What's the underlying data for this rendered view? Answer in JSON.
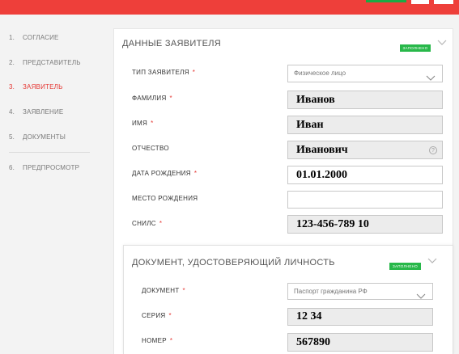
{
  "sidebar": {
    "items": [
      {
        "num": "1.",
        "label": "СОГЛАСИЕ"
      },
      {
        "num": "2.",
        "label": "ПРЕДСТАВИТЕЛЬ"
      },
      {
        "num": "3.",
        "label": "ЗАЯВИТЕЛЬ"
      },
      {
        "num": "4.",
        "label": "ЗАЯВЛЕНИЕ"
      },
      {
        "num": "5.",
        "label": "ДОКУМЕНТЫ"
      },
      {
        "num": "6.",
        "label": "ПРЕДПРОСМОТР"
      }
    ],
    "active_index": 2
  },
  "applicant": {
    "title": "ДАННЫЕ ЗАЯВИТЕЛЯ",
    "badge": "ЗАПОЛНЕНО",
    "required_mark": "*",
    "applicant_type": {
      "label": "ТИП ЗАЯВИТЕЛЯ",
      "value": "Физическое лицо"
    },
    "surname": {
      "label": "ФАМИЛИЯ",
      "value": "Иванов"
    },
    "name": {
      "label": "ИМЯ",
      "value": "Иван"
    },
    "patronymic": {
      "label": "ОТЧЕСТВО",
      "value": "Иванович",
      "help": "?"
    },
    "birth_date": {
      "label": "ДАТА РОЖДЕНИЯ",
      "value": "01.01.2000"
    },
    "birth_place": {
      "label": "МЕСТО РОЖДЕНИЯ",
      "value": ""
    },
    "snils": {
      "label": "СНИЛС",
      "value": "123-456-789 10"
    }
  },
  "identity_document": {
    "title": "ДОКУМЕНТ, УДОСТОВЕРЯЮЩИЙ ЛИЧНОСТЬ",
    "badge": "ЗАПОЛНЕНО",
    "document": {
      "label": "ДОКУМЕНТ",
      "value": "Паспорт гражданина РФ"
    },
    "series": {
      "label": "СЕРИЯ",
      "value": "12 34"
    },
    "number": {
      "label": "НОМЕР",
      "value": "567890"
    }
  },
  "colors": {
    "accent": "#ee3f3a",
    "badge": "#28b84a",
    "required": "#e53935"
  },
  "icons": {
    "dropdown": "chevron-down-icon",
    "help": "question-circle-icon"
  }
}
